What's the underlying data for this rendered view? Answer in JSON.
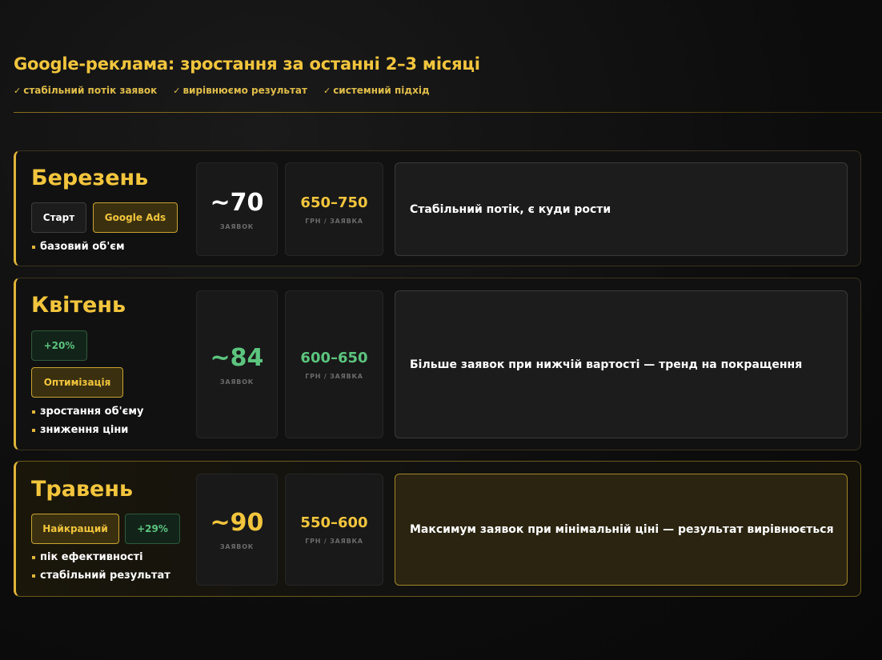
{
  "header": {
    "title": "Google-реклама: зростання за останні 2–3 місяці",
    "checks": [
      "стабільний потік заявок",
      "вирівнюємо результат",
      "системний підхід"
    ]
  },
  "months": [
    {
      "name": "Березень",
      "tags": [
        "Старт",
        "Google Ads"
      ],
      "bullets": [
        "базовий об'єм"
      ],
      "leads": "~70",
      "leads_label": "ЗАЯВОК",
      "price": "650–750",
      "price_label": "ГРН / ЗАЯВКА",
      "description": "Стабільний потік, є куди рости"
    },
    {
      "name": "Квітень",
      "tags": [
        "+20%",
        "Оптимізація"
      ],
      "bullets": [
        "зростання об'єму",
        "зниження ціни"
      ],
      "leads": "~84",
      "leads_label": "ЗАЯВОК",
      "price": "600–650",
      "price_label": "ГРН / ЗАЯВКА",
      "description": "Більше заявок при нижчій вартості — тренд на покращення"
    },
    {
      "name": "Травень",
      "tags": [
        "Найкращий",
        "+29%"
      ],
      "bullets": [
        "пік ефективності",
        "стабільний результат"
      ],
      "leads": "~90",
      "leads_label": "ЗАЯВОК",
      "price": "550–600",
      "price_label": "ГРН / ЗАЯВКА",
      "description": "Максимум заявок при мінімальній ціні — результат вирівнюється"
    }
  ],
  "colors": {
    "gold": "#f2c53d",
    "green": "#5cc47e",
    "background": "#0d0d0d"
  }
}
